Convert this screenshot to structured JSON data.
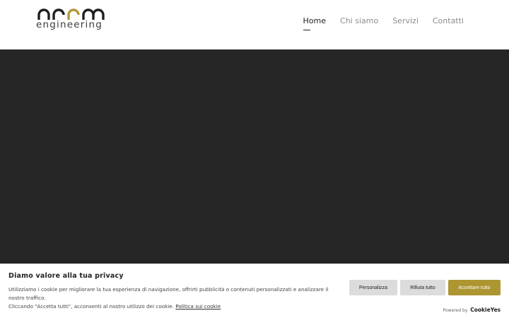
{
  "header": {
    "logo": {
      "word": "arco",
      "subtitle": "engineering",
      "accent_color": "#b29a3c",
      "dark_color": "#1f1f1f"
    },
    "nav": [
      {
        "label": "Home",
        "active": true
      },
      {
        "label": "Chi siamo",
        "active": false
      },
      {
        "label": "Servizi",
        "active": false
      },
      {
        "label": "Contatti",
        "active": false
      }
    ]
  },
  "hero": {
    "background_color": "#262626"
  },
  "cookie_banner": {
    "title": "Diamo valore alla tua privacy",
    "text_line1": "Utilizziamo i cookie per migliorare la tua esperienza di navigazione, offrirti pubblicità o contenuti personalizzati e analizzare il nostro traffico.",
    "text_line2": "Cliccando \"Accetta tutti\", acconsenti al nostro utilizzo dei cookie.",
    "policy_link": "Politica sui cookie",
    "buttons": {
      "customize": "Personalizza",
      "reject": "Rifiuta tutto",
      "accept": "Accettare tutto"
    },
    "accept_color": "#ad9532",
    "powered_by": "Powered by",
    "powered_brand": "CookieYes"
  }
}
